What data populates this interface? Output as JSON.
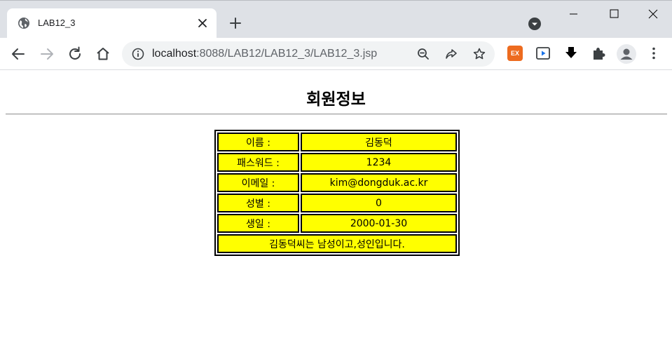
{
  "browser": {
    "tab_title": "LAB12_3",
    "url_host": "localhost",
    "url_rest": ":8088/LAB12/LAB12_3/LAB12_3.jsp",
    "extension_ex_label": "EX"
  },
  "page": {
    "heading": "회원정보",
    "rows": [
      {
        "label": "이름 :",
        "value": "김동덕"
      },
      {
        "label": "패스워드 :",
        "value": "1234"
      },
      {
        "label": "이메일 :",
        "value": "kim@dongduk.ac.kr"
      },
      {
        "label": "성별 :",
        "value": "0"
      },
      {
        "label": "생일 :",
        "value": "2000-01-30"
      }
    ],
    "summary": "김동덕씨는 남성이고,성인입니다."
  },
  "colors": {
    "cell_background": "#ffff00",
    "tabstrip_background": "#dee1e6"
  }
}
